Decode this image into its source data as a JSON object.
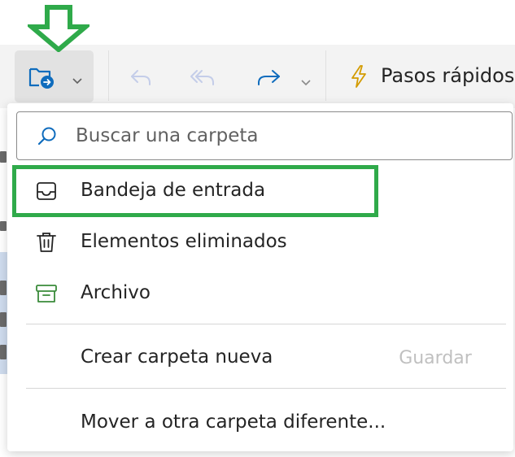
{
  "toolbar": {
    "move_button_icon": "folder-move-icon",
    "move_button_chevron": "chevron-down-icon",
    "reply_icon": "reply-icon",
    "reply_all_icon": "reply-all-icon",
    "forward_icon": "forward-icon",
    "forward_chevron": "chevron-down-icon",
    "quick_steps_icon": "lightning-icon",
    "quick_steps_label": "Pasos rápidos"
  },
  "annotation": {
    "arrow_icon": "down-arrow-icon",
    "color": "#2faa4a"
  },
  "dropdown": {
    "search": {
      "icon": "search-icon",
      "placeholder": "Buscar una carpeta",
      "value": ""
    },
    "items": [
      {
        "icon": "inbox-icon",
        "label": "Bandeja de entrada",
        "highlighted": true
      },
      {
        "icon": "trash-icon",
        "label": "Elementos eliminados",
        "highlighted": false
      },
      {
        "icon": "archive-icon",
        "label": "Archivo",
        "highlighted": false
      }
    ],
    "create_folder": {
      "label": "Crear carpeta nueva",
      "save_label": "Guardar"
    },
    "move_other_label": "Mover a otra carpeta diferente..."
  },
  "colors": {
    "accent": "#0f6cbd",
    "toolbar_bg": "#f3f3f3",
    "icon_disabled": "#c4cde9",
    "archive_green": "#3a8b3a",
    "quick_steps_yellow": "#d39b00"
  }
}
